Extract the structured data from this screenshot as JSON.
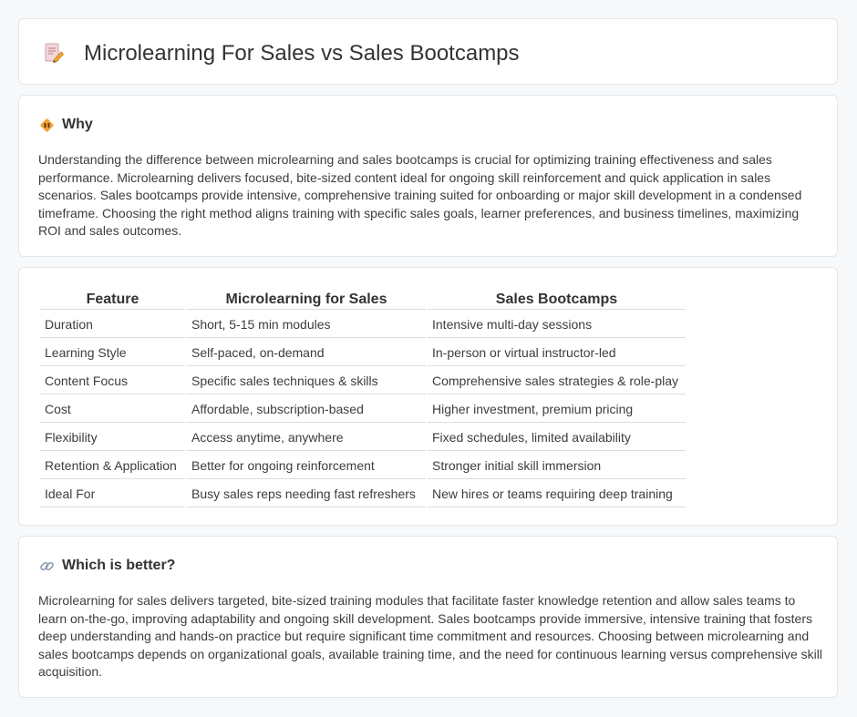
{
  "header": {
    "title": "Microlearning For Sales vs Sales Bootcamps",
    "icon": "document-pencil-icon"
  },
  "why": {
    "title": "Why",
    "icon": "warning-diamond-icon",
    "text": "Understanding the difference between microlearning and sales bootcamps is crucial for optimizing training effectiveness and sales performance. Microlearning delivers focused, bite-sized content ideal for ongoing skill reinforcement and quick application in sales scenarios. Sales bootcamps provide intensive, comprehensive training suited for onboarding or major skill development in a condensed timeframe. Choosing the right method aligns training with specific sales goals, learner preferences, and business timelines, maximizing ROI and sales outcomes."
  },
  "table": {
    "headers": [
      "Feature",
      "Microlearning for Sales",
      "Sales Bootcamps"
    ],
    "rows": [
      [
        "Duration",
        "Short, 5-15 min modules",
        "Intensive multi-day sessions"
      ],
      [
        "Learning Style",
        "Self-paced, on-demand",
        "In-person or virtual instructor-led"
      ],
      [
        "Content Focus",
        "Specific sales techniques & skills",
        "Comprehensive sales strategies & role-play"
      ],
      [
        "Cost",
        "Affordable, subscription-based",
        "Higher investment, premium pricing"
      ],
      [
        "Flexibility",
        "Access anytime, anywhere",
        "Fixed schedules, limited availability"
      ],
      [
        "Retention & Application",
        "Better for ongoing reinforcement",
        "Stronger initial skill immersion"
      ],
      [
        "Ideal For",
        "Busy sales reps needing fast refreshers",
        "New hires or teams requiring deep training"
      ]
    ]
  },
  "which": {
    "title": "Which is better?",
    "icon": "link-icon",
    "text": "Microlearning for sales delivers targeted, bite-sized training modules that facilitate faster knowledge retention and allow sales teams to learn on-the-go, improving adaptability and ongoing skill development. Sales bootcamps provide immersive, intensive training that fosters deep understanding and hands-on practice but require significant time commitment and resources. Choosing between microlearning and sales bootcamps depends on organizational goals, available training time, and the need for continuous learning versus comprehensive skill acquisition."
  },
  "colors": {
    "accent": "#e8a23a",
    "border": "#e3e6ea",
    "background": "#f7f8fa"
  }
}
